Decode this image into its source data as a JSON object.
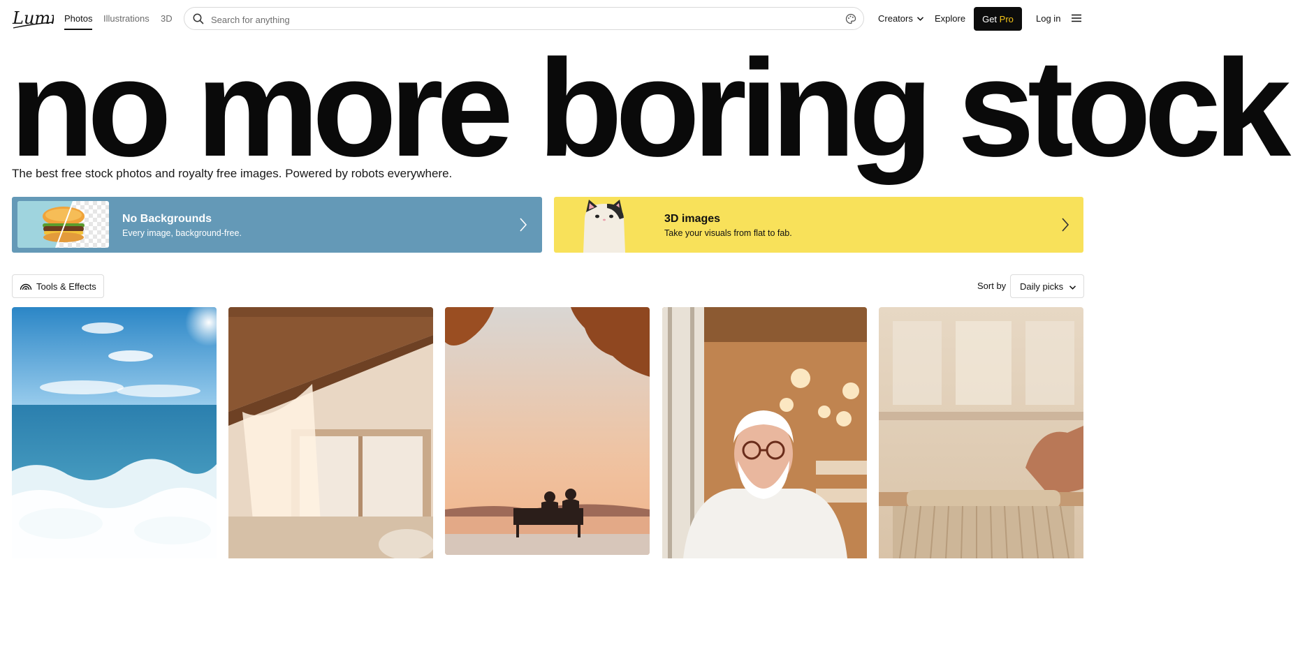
{
  "header": {
    "logo_text": "Lummi",
    "tabs": [
      {
        "label": "Photos",
        "active": true
      },
      {
        "label": "Illustrations",
        "active": false
      },
      {
        "label": "3D",
        "active": false
      }
    ],
    "search": {
      "placeholder": "Search for anything",
      "value": ""
    },
    "creators_label": "Creators",
    "explore_label": "Explore",
    "get_label": "Get",
    "pro_label": "Pro",
    "login_label": "Log in"
  },
  "hero": {
    "title": "no more boring stock",
    "subtitle": "The best free stock photos and royalty free images. Powered by robots everywhere."
  },
  "promos": [
    {
      "title": "No Backgrounds",
      "subtitle": "Every image, background-free.",
      "color": "#6499b7"
    },
    {
      "title": "3D images",
      "subtitle": "Take your visuals from flat to fab.",
      "color": "#f8e15a"
    }
  ],
  "toolbar": {
    "tools_label": "Tools & Effects",
    "sort_label": "Sort by",
    "sort_value": "Daily picks"
  },
  "photos": [
    {
      "subject": "ocean-waves"
    },
    {
      "subject": "sunlit-bedroom-window"
    },
    {
      "subject": "couple-on-bench-sunset"
    },
    {
      "subject": "smiling-chef-portrait"
    },
    {
      "subject": "hand-weaving-loom"
    }
  ],
  "colors": {
    "accent_pro": "#f5c518",
    "button_dark": "#0c0c0c",
    "promo_blue": "#6499b7",
    "promo_yellow": "#f8e15a"
  }
}
